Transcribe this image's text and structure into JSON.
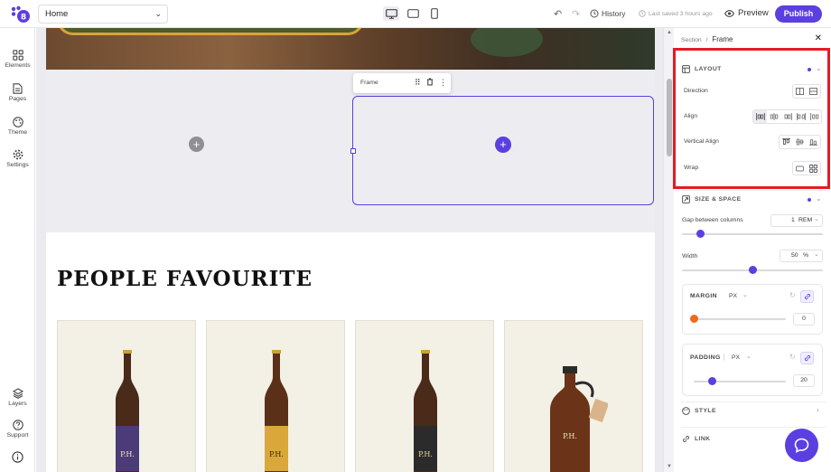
{
  "topbar": {
    "page_name": "Home",
    "history_label": "History",
    "saved_status": "Last saved 3 hours ago",
    "preview_label": "Preview",
    "publish_label": "Publish"
  },
  "leftnav": {
    "elements": "Elements",
    "pages": "Pages",
    "theme": "Theme",
    "settings": "Settings",
    "layers": "Layers",
    "support": "Support"
  },
  "canvas": {
    "frame_toolbar_label": "Frame",
    "heading": "PEOPLE FAVOURITE"
  },
  "panel": {
    "breadcrumb_root": "Section",
    "breadcrumb_sep": "/",
    "breadcrumb_current": "Frame",
    "layout": {
      "title": "LAYOUT",
      "direction": "Direction",
      "align": "Align",
      "vertical_align": "Vertical Align",
      "wrap": "Wrap"
    },
    "size_space": {
      "title": "SIZE & SPACE",
      "gap_label": "Gap between columns",
      "gap_value": "1",
      "gap_unit": "REM",
      "gap_slider": 0.13,
      "width_label": "Width",
      "width_value": "50",
      "width_unit": "%",
      "width_slider": 0.5,
      "margin_label": "MARGIN",
      "margin_unit": "PX",
      "margin_value": "0",
      "margin_slider": 0.0,
      "padding_label": "PADDING",
      "padding_unit": "PX",
      "padding_value": "20",
      "padding_slider": 0.2
    },
    "style_title": "STYLE",
    "link_title": "LINK"
  },
  "colors": {
    "accent": "#5b3fe0",
    "highlight": "#e31c24",
    "margin_knob": "#f06a1c"
  }
}
